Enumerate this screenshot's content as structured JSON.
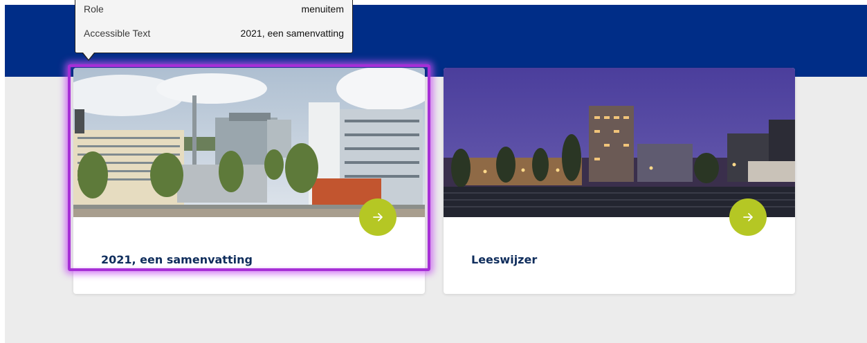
{
  "colors": {
    "hero_band": "#002d87",
    "page_background": "#ececec",
    "card_title": "#0f2d5c",
    "arrow_button": "#b5c724",
    "focus_ring": "#a62fd6"
  },
  "tooltip": {
    "rows": [
      {
        "key": "Role",
        "value": "menuitem"
      },
      {
        "key": "Accessible Text",
        "value": "2021, een samenvatting"
      }
    ]
  },
  "cards": [
    {
      "title": "2021, een samenvatting",
      "image": "city-daytime-photo",
      "icon": "arrow-right-icon",
      "focused": true
    },
    {
      "title": "Leeswijzer",
      "image": "city-night-photo",
      "icon": "arrow-right-icon",
      "focused": false
    }
  ]
}
